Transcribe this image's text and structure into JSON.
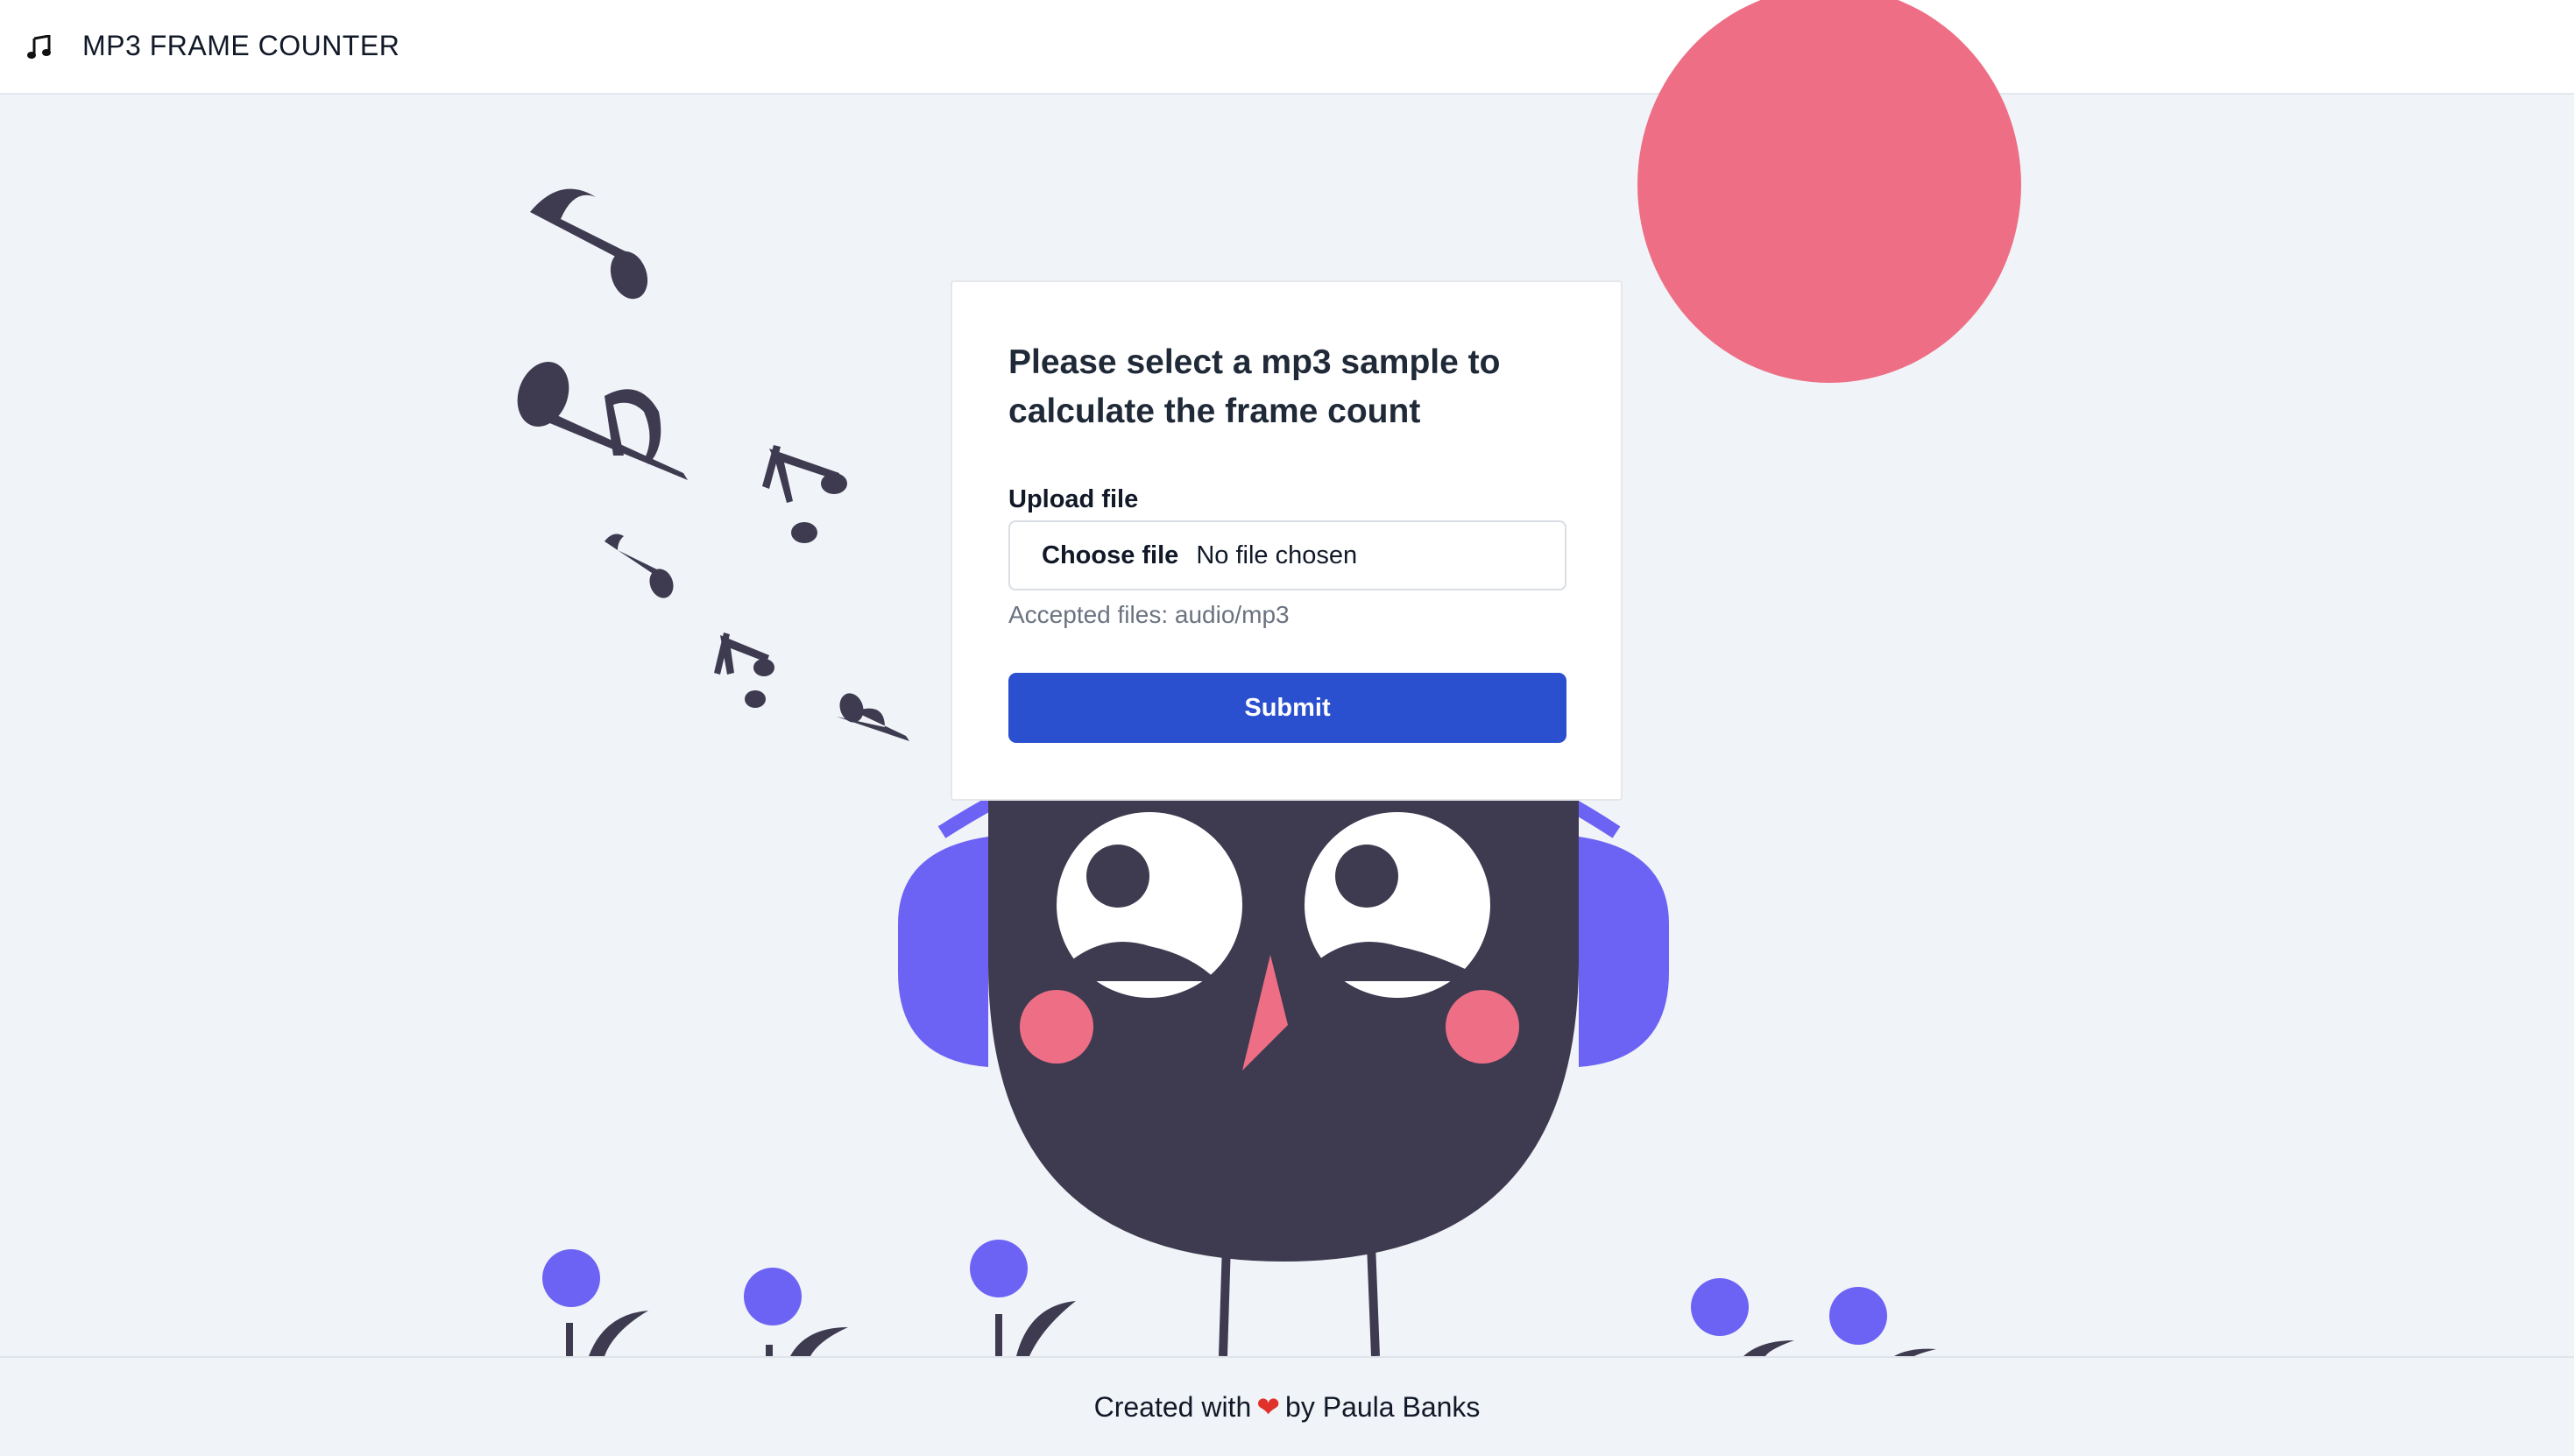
{
  "header": {
    "logo_icon": "music-note-icon",
    "title": "MP3 FRAME COUNTER"
  },
  "form": {
    "title": "Please select a mp3 sample to calculate the frame count",
    "upload_label": "Upload file",
    "choose_button": "Choose file",
    "file_status": "No file chosen",
    "hint": "Accepted files: audio/mp3",
    "submit_label": "Submit"
  },
  "footer": {
    "prefix": "Created with",
    "heart_icon": "heart-icon",
    "heart": "❤",
    "suffix": "by Paula Banks"
  },
  "colors": {
    "accent": "#2a4fcf",
    "sun": "#ee6f85",
    "bird": "#3e3b50",
    "headphones": "#6c63f5",
    "cheeks": "#ee6f85"
  }
}
